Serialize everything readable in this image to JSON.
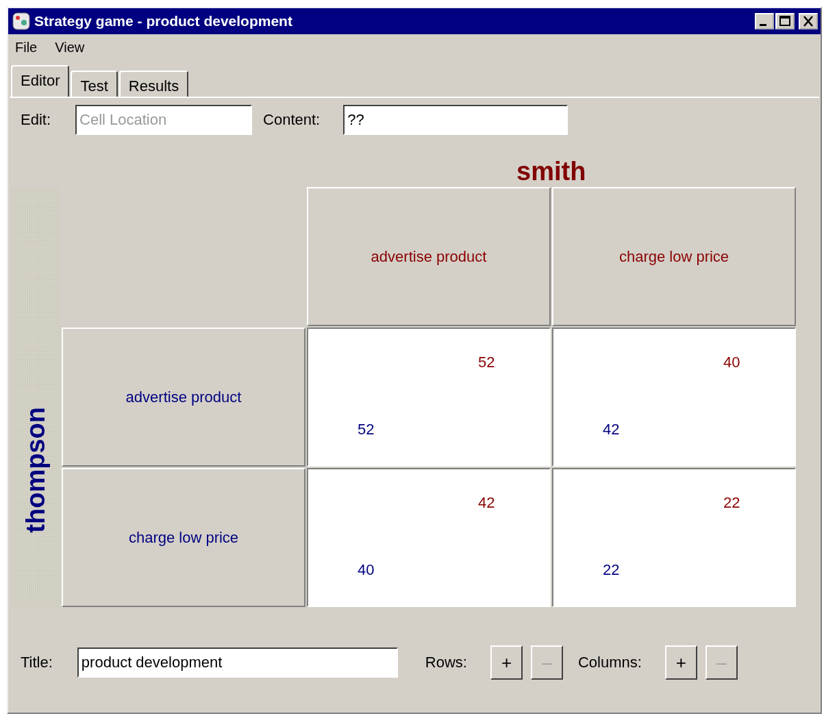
{
  "window": {
    "title": "Strategy game - product development"
  },
  "menu": [
    "File",
    "View"
  ],
  "tabs": [
    {
      "label": "Editor",
      "selected": true
    },
    {
      "label": "Test",
      "selected": false
    },
    {
      "label": "Results",
      "selected": false
    }
  ],
  "edit": {
    "label": "Edit:",
    "placeholder": "Cell Location"
  },
  "content": {
    "label": "Content:",
    "value": "??"
  },
  "game": {
    "column_player": "smith",
    "row_player": "thompson",
    "column_strategies": [
      "advertise product",
      "charge low price"
    ],
    "row_strategies": [
      "advertise product",
      "charge low price"
    ],
    "cells": [
      [
        {
          "column_payoff": "52",
          "row_payoff": "52"
        },
        {
          "column_payoff": "40",
          "row_payoff": "42"
        }
      ],
      [
        {
          "column_payoff": "42",
          "row_payoff": "40"
        },
        {
          "column_payoff": "22",
          "row_payoff": "22"
        }
      ]
    ]
  },
  "title_field": {
    "label": "Title:",
    "value": "product development"
  },
  "rows_control": {
    "label": "Rows:",
    "buttons": [
      {
        "symbol": "+",
        "disabled": false
      },
      {
        "symbol": "–",
        "disabled": true
      }
    ]
  },
  "columns_control": {
    "label": "Columns:",
    "buttons": [
      {
        "symbol": "+",
        "disabled": false
      },
      {
        "symbol": "–",
        "disabled": true
      }
    ]
  }
}
